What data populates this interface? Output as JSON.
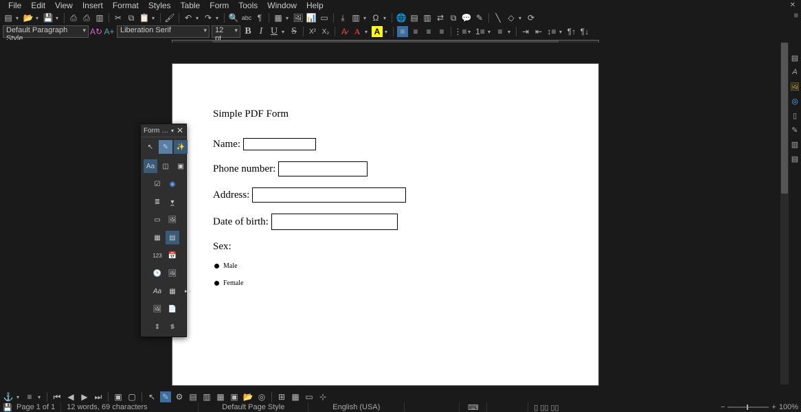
{
  "menu": {
    "items": [
      "File",
      "Edit",
      "View",
      "Insert",
      "Format",
      "Styles",
      "Table",
      "Form",
      "Tools",
      "Window",
      "Help"
    ]
  },
  "toolbar2": {
    "paragraph_style": "Default Paragraph Style",
    "font_name": "Liberation Serif",
    "font_size": "12 pt"
  },
  "document": {
    "title": "Simple PDF Form",
    "name_label": "Name:",
    "phone_label": "Phone number:",
    "address_label": "Address:",
    "dob_label": "Date of birth:",
    "sex_label": "Sex:",
    "radio_male": "Male",
    "radio_female": "Female"
  },
  "form_toolbar": {
    "title": "Form …"
  },
  "status": {
    "page": "Page 1 of 1",
    "words": "12 words, 69 characters",
    "page_style": "Default Page Style",
    "language": "English (USA)",
    "zoom": "100%"
  }
}
